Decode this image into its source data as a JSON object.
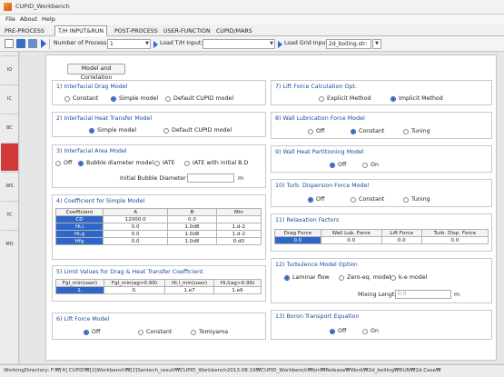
{
  "window": {
    "title": "CUPID_Workbench"
  },
  "menu": {
    "items": [
      "File",
      "About",
      "Help"
    ]
  },
  "tabs": [
    "PRE-PROCESS",
    "T/H INPUT&RUN",
    "POST-PROCESS",
    "USER-FUNCTION",
    "CUPID/MARS"
  ],
  "active_tab": "T/H INPUT&RUN",
  "toolbar": {
    "process_label": "Number of Process :",
    "process_value": "1",
    "load_th_label": "Load T/H Input:",
    "load_th_value": "",
    "load_grid_label": "Load Grid Input",
    "load_grid_value": "2d_boiling.str:"
  },
  "sidebar": {
    "items": [
      "IO",
      "IC",
      "BC",
      "M",
      "WS",
      "TC",
      "MO"
    ]
  },
  "model_button": "Model and Correlation",
  "g1": {
    "title": "1) Interfacial Drag Model",
    "options": [
      "Constant",
      "Simple model",
      "Default CUPID model"
    ],
    "selected": 1
  },
  "g2": {
    "title": "2) Interfacial Heat Transfer Model",
    "options": [
      "Simple model",
      "Default CUPID model"
    ],
    "selected": 0
  },
  "g3": {
    "title": "3) Interfacial Area Model",
    "options": [
      "Off",
      "Bubble diameter model",
      "IATE",
      "IATE with initial B.D"
    ],
    "selected": 1,
    "bubble_label": "Initial Bubble Diameter",
    "bubble_value": "",
    "bubble_unit": "m"
  },
  "g4": {
    "title": "4) Coefficient for Simple Model",
    "headers": [
      "Coefficient",
      "A",
      "B",
      "Min"
    ],
    "rows": [
      [
        "CD",
        "12000.0",
        "0.0",
        ""
      ],
      [
        "Hi,l",
        "0.0",
        "1.0d8",
        "1.d-2"
      ],
      [
        "Hi,g",
        "0.0",
        "1.0d8",
        "1.d-2"
      ],
      [
        "Hfg",
        "0.0",
        "1.0d8",
        "0.d0"
      ]
    ]
  },
  "g5": {
    "title": "5) Limit Values for Drag & Heat Transfer Coefficient",
    "headers": [
      "Fgl_min(user)",
      "Fgl_min(ag>0.99)",
      "Hi,l_min(user)",
      "Hi,l(ag>0.99)"
    ],
    "row": [
      "1.",
      "0.",
      "1.e7",
      "1.e6"
    ]
  },
  "g6": {
    "title": "6) Lift Force Model",
    "options": [
      "Off",
      "Constant",
      "Tomiyama"
    ],
    "selected": 0
  },
  "g7": {
    "title": "7) Lift Force Calculation Opt.",
    "options": [
      "Explicit Method",
      "Implicit Method"
    ],
    "selected": 1
  },
  "g8": {
    "title": "8) Wall Lubrication Force Model",
    "options": [
      "Off",
      "Constant",
      "Tuning"
    ],
    "selected": 1
  },
  "g9": {
    "title": "9) Wall Heat Partitioning Model",
    "options": [
      "Off",
      "On"
    ],
    "selected": 0
  },
  "g10": {
    "title": "10) Turb. Dispersion Force Model",
    "options": [
      "Off",
      "Constant",
      "Tuning"
    ],
    "selected": 0
  },
  "g11": {
    "title": "11) Relaxation Factors",
    "headers": [
      "Drag Force",
      "Wall Lub. Force",
      "Lift Force",
      "Turb. Disp. Force"
    ],
    "row": [
      "0.0",
      "0.0",
      "0.0",
      "0.0"
    ]
  },
  "g12": {
    "title": "12) Turbulence Model Option",
    "options": [
      "Laminar flow",
      "Zero-eq. model",
      "k-e model"
    ],
    "selected": 0,
    "mixing_label": "Mixing Length:",
    "mixing_value": "0.0",
    "mixing_unit": "m"
  },
  "g13": {
    "title": "13) Boron Transport Equation",
    "options": [
      "Off",
      "On"
    ],
    "selected": 0
  },
  "status": {
    "text": "WorkingDirectory: F:₩[4] CUPID₩[2]Workbench₩[2]Sentech_result₩CUPID_Workbench2013.08.19₩CUPID_Workbench₩bin₩Release₩Work₩2d_boiling₩RUN₩2d.Case₩"
  },
  "colors": {
    "accent": "#2f66c9",
    "group_title": "#1a4a9e",
    "side_active": "#d23a3a"
  }
}
